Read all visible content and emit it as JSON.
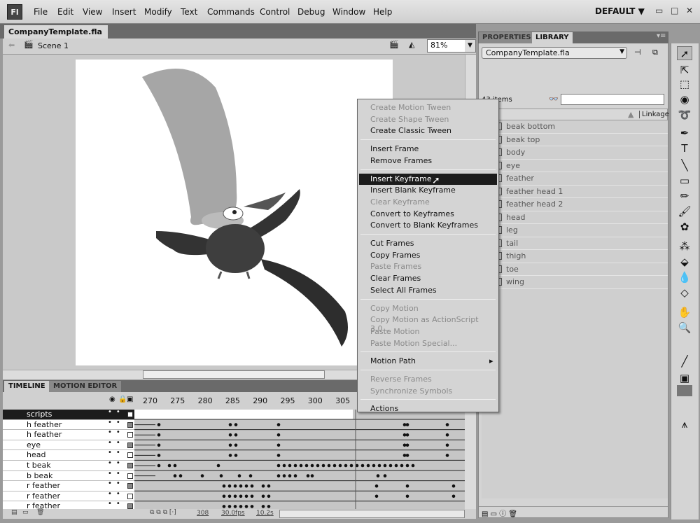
{
  "app": {
    "logo": "Fl",
    "menus": [
      "File",
      "Edit",
      "View",
      "Insert",
      "Modify",
      "Text",
      "Commands",
      "Control",
      "Debug",
      "Window",
      "Help"
    ],
    "workspace": "DEFAULT"
  },
  "document": {
    "tab": "CompanyTemplate.fla",
    "close": "×",
    "scene": "Scene 1",
    "zoom": "81%"
  },
  "timeline": {
    "tabs": [
      "TIMELINE",
      "MOTION EDITOR"
    ],
    "ticks": [
      "270",
      "275",
      "280",
      "285",
      "290",
      "295",
      "300",
      "305"
    ],
    "layers": [
      {
        "name": "scripts",
        "selected": true
      },
      {
        "name": "h feather"
      },
      {
        "name": "h feather"
      },
      {
        "name": "eye"
      },
      {
        "name": "head"
      },
      {
        "name": "t beak"
      },
      {
        "name": "b beak"
      },
      {
        "name": "r feather"
      },
      {
        "name": "r feather"
      },
      {
        "name": "r feather"
      }
    ],
    "current_frame": "308",
    "fps": "30.0",
    "fps_unit": "fps",
    "elapsed": "10.2",
    "elapsed_unit": "s"
  },
  "panel": {
    "tabs": [
      "PROPERTIES",
      "LIBRARY"
    ],
    "library_file": "CompanyTemplate.fla",
    "item_count": "43 items",
    "linkage_header": "Linkage",
    "items": [
      "beak bottom",
      "beak top",
      "body",
      "eye",
      "feather",
      "feather head 1",
      "feather head 2",
      "head",
      "leg",
      "tail",
      "thigh",
      "toe",
      "wing"
    ]
  },
  "context_menu": {
    "groups": [
      [
        {
          "label": "Create Motion Tween",
          "disabled": true
        },
        {
          "label": "Create Shape Tween",
          "disabled": true
        },
        {
          "label": "Create Classic Tween"
        }
      ],
      [
        {
          "label": "Insert Frame"
        },
        {
          "label": "Remove Frames"
        }
      ],
      [
        {
          "label": "Insert Keyframe",
          "highlighted": true
        },
        {
          "label": "Insert Blank Keyframe"
        },
        {
          "label": "Clear Keyframe",
          "disabled": true
        },
        {
          "label": "Convert to Keyframes"
        },
        {
          "label": "Convert to Blank Keyframes"
        }
      ],
      [
        {
          "label": "Cut Frames"
        },
        {
          "label": "Copy Frames"
        },
        {
          "label": "Paste Frames",
          "disabled": true
        },
        {
          "label": "Clear Frames"
        },
        {
          "label": "Select All Frames"
        }
      ],
      [
        {
          "label": "Copy Motion",
          "disabled": true
        },
        {
          "label": "Copy Motion as ActionScript 3.0...",
          "disabled": true
        },
        {
          "label": "Paste Motion",
          "disabled": true
        },
        {
          "label": "Paste Motion Special...",
          "disabled": true
        }
      ],
      [
        {
          "label": "Motion Path",
          "submenu": true
        }
      ],
      [
        {
          "label": "Reverse Frames",
          "disabled": true
        },
        {
          "label": "Synchronize Symbols",
          "disabled": true
        }
      ],
      [
        {
          "label": "Actions"
        }
      ]
    ]
  },
  "tools": [
    "selection",
    "subselection",
    "free-transform",
    "3d-rotation",
    "lasso",
    "pen",
    "text",
    "line",
    "rectangle",
    "pencil",
    "brush",
    "deco",
    "bone",
    "paint-bucket",
    "eyedropper",
    "eraser",
    "hand",
    "zoom",
    "stroke-color",
    "fill-color",
    "swap-colors",
    "snap"
  ]
}
